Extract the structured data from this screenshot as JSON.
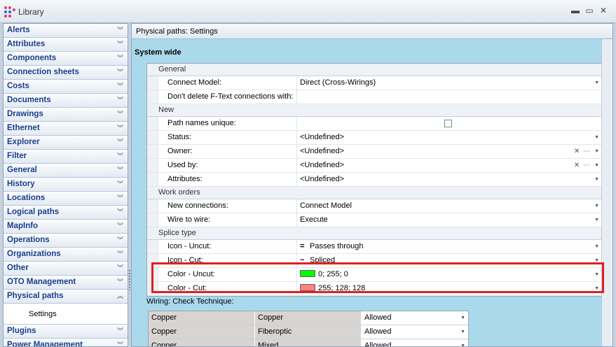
{
  "window": {
    "title": "Library",
    "colors": {
      "accent": "#1a3e8c",
      "highlight": "#e02020",
      "panel_bg": "#aad9ec"
    }
  },
  "sidebar": {
    "items": [
      {
        "label": "Alerts"
      },
      {
        "label": "Attributes"
      },
      {
        "label": "Components"
      },
      {
        "label": "Connection sheets"
      },
      {
        "label": "Costs"
      },
      {
        "label": "Documents"
      },
      {
        "label": "Drawings"
      },
      {
        "label": "Ethernet"
      },
      {
        "label": "Explorer"
      },
      {
        "label": "Filter"
      },
      {
        "label": "General"
      },
      {
        "label": "History"
      },
      {
        "label": "Locations"
      },
      {
        "label": "Logical paths"
      },
      {
        "label": "MapInfo"
      },
      {
        "label": "Operations"
      },
      {
        "label": "Organizations"
      },
      {
        "label": "Other"
      },
      {
        "label": "OTO Management"
      },
      {
        "label": "Physical paths",
        "expanded": true
      },
      {
        "label": "Plugins"
      },
      {
        "label": "Power Management"
      }
    ],
    "sub_item": "Settings"
  },
  "panel": {
    "header": "Physical paths: Settings",
    "section_title": "System wide",
    "categories": {
      "general": "General",
      "new": "New",
      "work_orders": "Work orders",
      "splice_type": "Splice type"
    },
    "rows": {
      "connect_model": {
        "name": "Connect Model:",
        "value": "Direct (Cross-Wirings)"
      },
      "dont_delete": {
        "name": "Don't delete F-Text connections with:",
        "value": ""
      },
      "path_names_unique": {
        "name": "Path names unique:"
      },
      "status": {
        "name": "Status:",
        "value": "<Undefined>"
      },
      "owner": {
        "name": "Owner:",
        "value": "<Undefined>"
      },
      "used_by": {
        "name": "Used by:",
        "value": "<Undefined>"
      },
      "attributes": {
        "name": "Attributes:",
        "value": "<Undefined>"
      },
      "new_connections": {
        "name": "New connections:",
        "value": "Connect Model"
      },
      "wire_to_wire": {
        "name": "Wire to wire:",
        "value": "Execute"
      },
      "icon_uncut": {
        "name": "Icon - Uncut:",
        "value": "Passes through",
        "glyph": "="
      },
      "icon_cut": {
        "name": "Icon - Cut:",
        "value": "Spliced",
        "glyph": "~"
      },
      "color_uncut": {
        "name": "Color - Uncut:",
        "value": "0; 255; 0",
        "swatch": "#00ff00"
      },
      "color_cut": {
        "name": "Color - Cut:",
        "value": "255; 128; 128",
        "swatch": "#ff8080"
      }
    },
    "clear_glyph": "✕",
    "more_glyph": "⋯",
    "wiring": {
      "label": "Wiring: Check Technique:",
      "rows": [
        {
          "a": "Copper",
          "b": "Copper",
          "c": "Allowed"
        },
        {
          "a": "Copper",
          "b": "Fiberoptic",
          "c": "Allowed"
        },
        {
          "a": "Copper",
          "b": "Mixed",
          "c": "Allowed"
        }
      ]
    }
  }
}
